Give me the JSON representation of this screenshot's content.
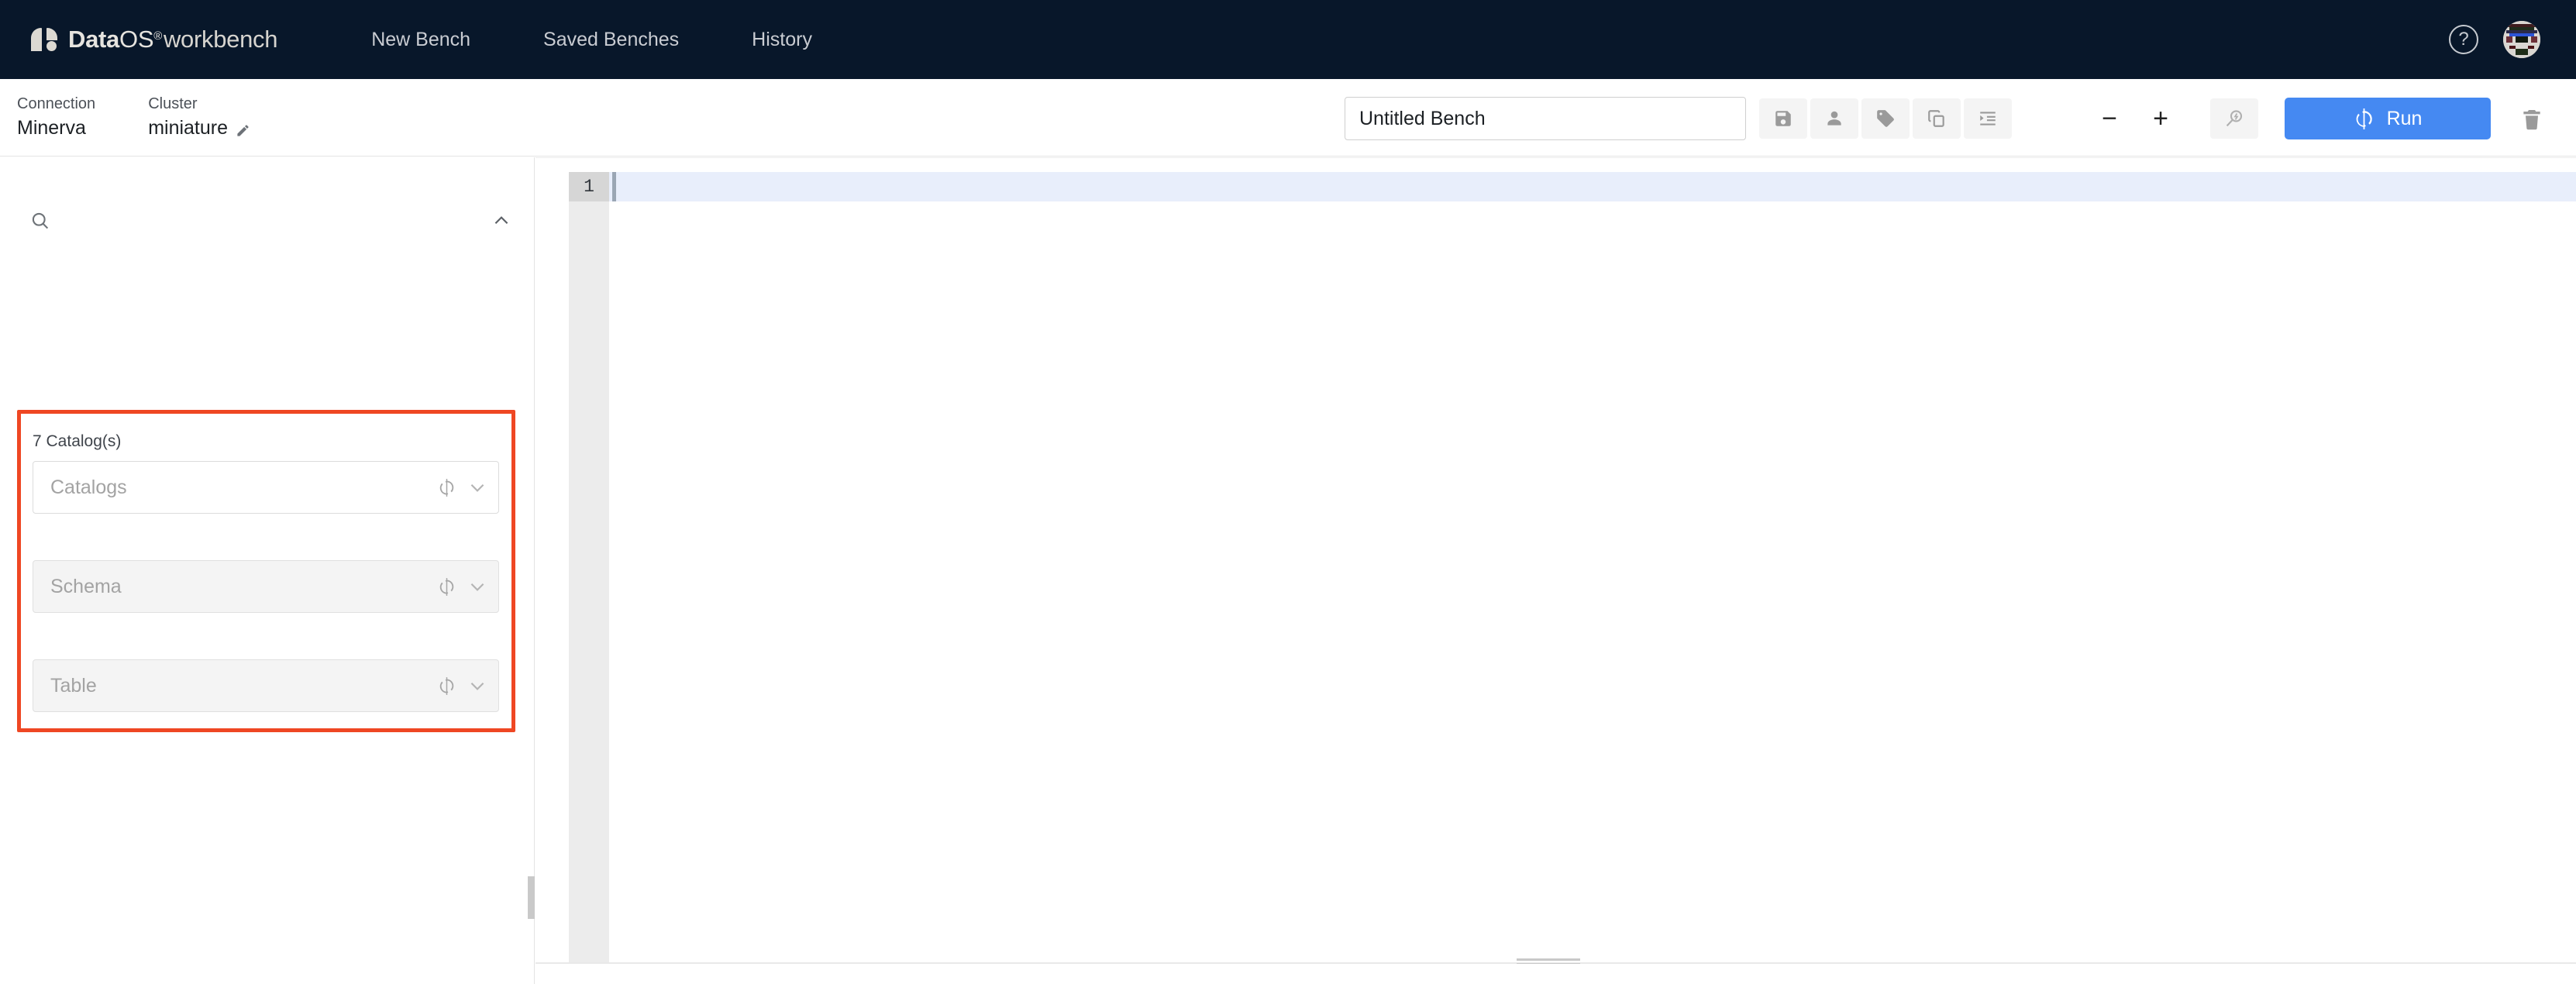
{
  "header": {
    "brand": {
      "logo_icon": "dataos-logo-icon",
      "data": "Data",
      "os": "OS",
      "registered": "®",
      "workbench": "workbench"
    },
    "nav": [
      {
        "label": "New Bench",
        "name": "nav-new-bench"
      },
      {
        "label": "Saved Benches",
        "name": "nav-saved-benches"
      },
      {
        "label": "History",
        "name": "nav-history"
      }
    ],
    "help_icon": "question-mark-icon",
    "help_label": "?",
    "avatar_icon": "user-avatar-identicon"
  },
  "toolbar": {
    "connection_label": "Connection",
    "connection_value": "Minerva",
    "cluster_label": "Cluster",
    "cluster_value": "miniature",
    "edit_icon": "pencil-icon",
    "bench_name_value": "Untitled Bench",
    "bench_name_placeholder": "Untitled Bench",
    "actions": [
      {
        "name": "save-button",
        "icon": "save-floppy-icon"
      },
      {
        "name": "share-user-button",
        "icon": "person-icon"
      },
      {
        "name": "tag-button",
        "icon": "tag-icon"
      },
      {
        "name": "copy-button",
        "icon": "copy-icon"
      },
      {
        "name": "format-indent-button",
        "icon": "indent-icon"
      }
    ],
    "zoom_out_label": "−",
    "zoom_in_label": "+",
    "explain_icon": "magnifier-lightning-icon",
    "run_label": "Run",
    "run_icon": "refresh-sync-icon",
    "run_color": "#4589f2",
    "delete_icon": "trash-icon"
  },
  "sidebar": {
    "search_icon": "search-icon",
    "search_placeholder": "",
    "collapse_icon": "chevron-up-icon",
    "catalog_count": "7 Catalog(s)",
    "highlight_color": "#ef4723",
    "selectors": [
      {
        "name": "catalogs-select",
        "placeholder": "Catalogs",
        "enabled": true,
        "refresh_icon": "refresh-icon",
        "chevron_icon": "chevron-down-icon"
      },
      {
        "name": "schema-select",
        "placeholder": "Schema",
        "enabled": false,
        "refresh_icon": "refresh-icon",
        "chevron_icon": "chevron-down-icon"
      },
      {
        "name": "table-select",
        "placeholder": "Table",
        "enabled": false,
        "refresh_icon": "refresh-icon",
        "chevron_icon": "chevron-down-icon"
      }
    ],
    "resize_handle": "sidebar-resize-handle"
  },
  "editor": {
    "line_numbers": [
      "1"
    ],
    "content": "",
    "active_line": "1",
    "resize_handle": "editor-resize-handle"
  }
}
